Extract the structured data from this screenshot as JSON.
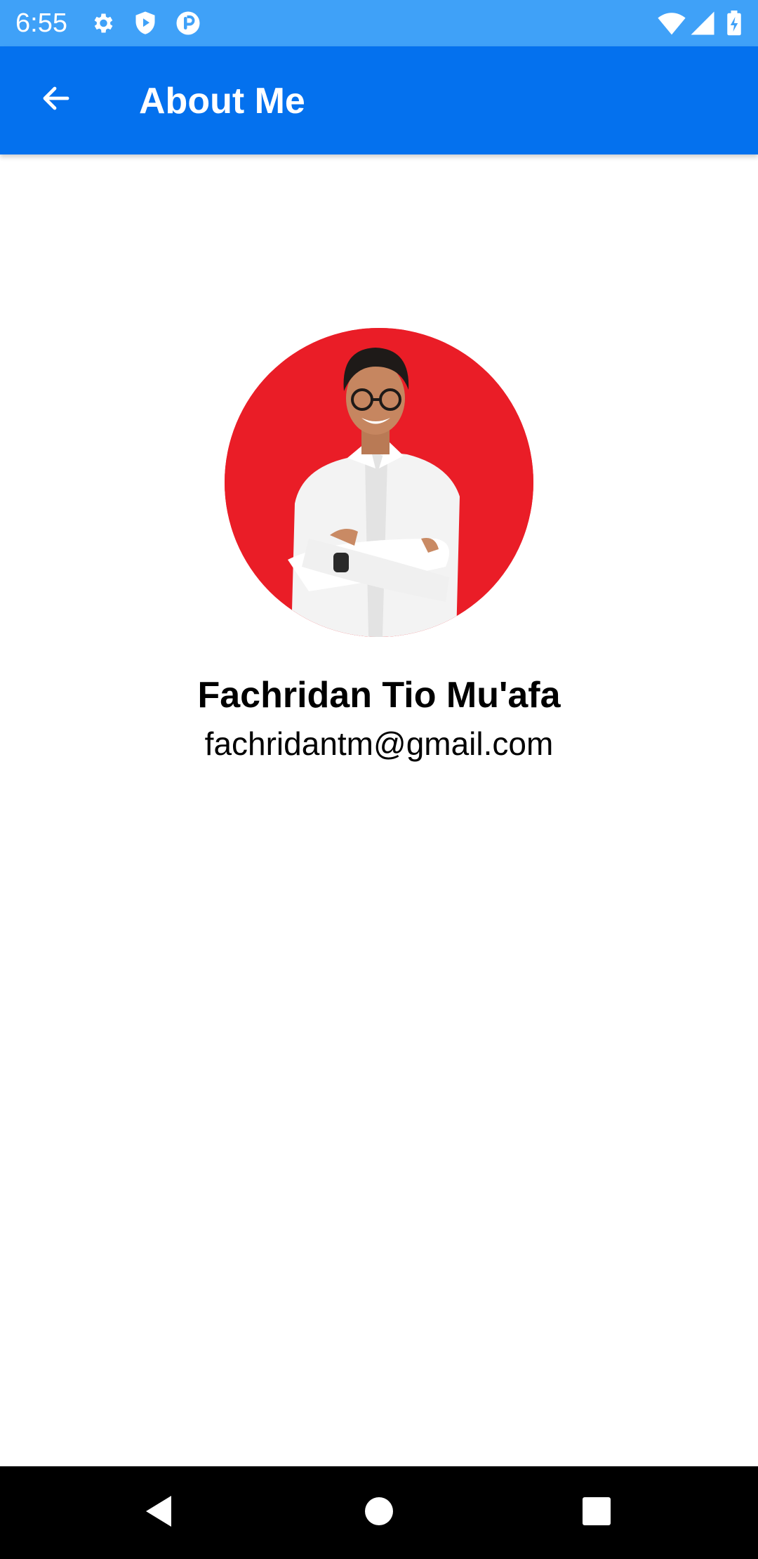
{
  "status_bar": {
    "time": "6:55",
    "background": "#3fa1f8",
    "left_icons": [
      "settings-gear-icon",
      "shield-play-icon",
      "pinterest-style-icon"
    ],
    "right_icons": [
      "wifi-icon",
      "cell-signal-icon",
      "battery-charging-icon"
    ]
  },
  "app_bar": {
    "title": "About Me",
    "background": "#0471ee",
    "back_icon": "arrow-left-icon"
  },
  "profile": {
    "avatar_background": "#ea1d27",
    "name": "Fachridan Tio Mu'afa",
    "email": "fachridantm@gmail.com"
  },
  "nav_bar": {
    "buttons": [
      "back-triangle-icon",
      "home-circle-icon",
      "recents-square-icon"
    ]
  }
}
